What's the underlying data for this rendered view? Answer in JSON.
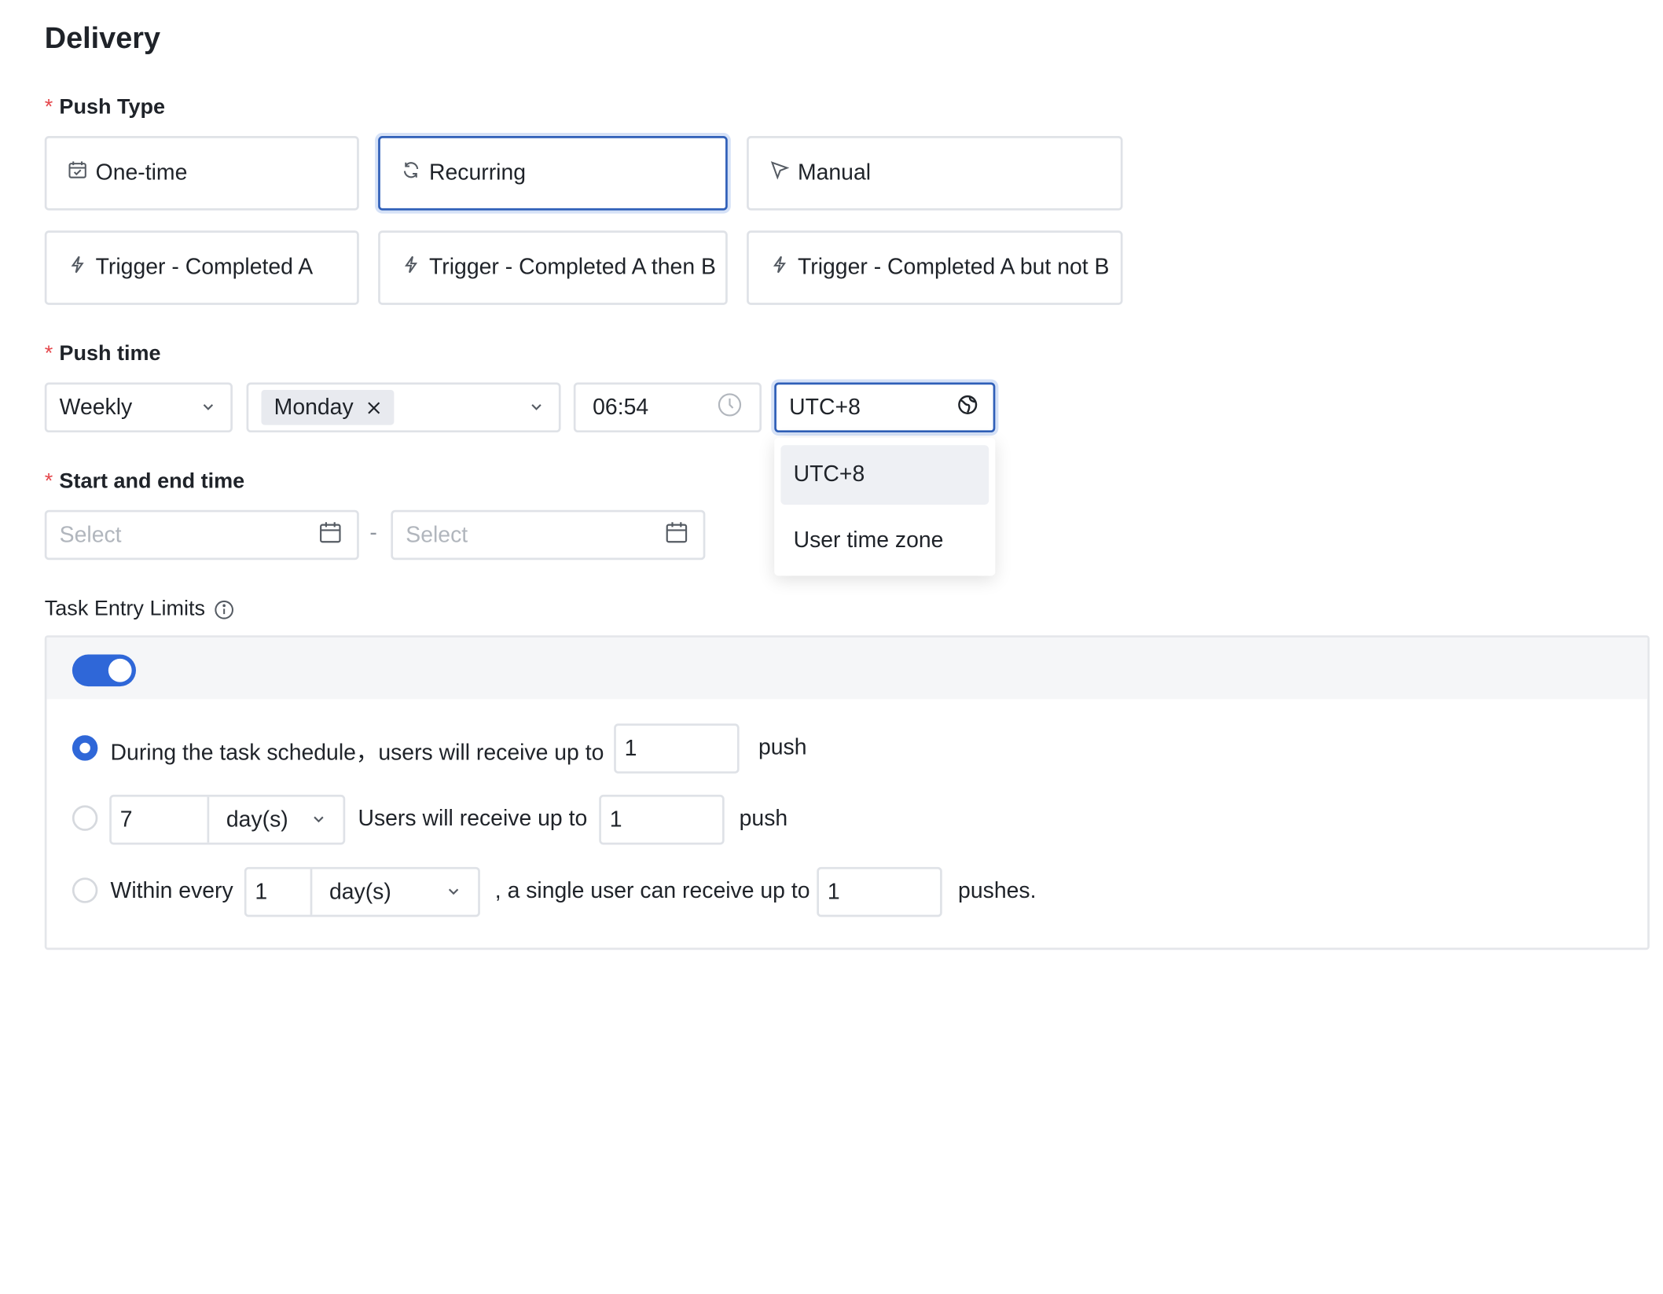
{
  "section_title": "Delivery",
  "push_type": {
    "label": "Push Type",
    "required_mark": "*",
    "options": [
      {
        "label": "One-time",
        "icon": "calendar-icon"
      },
      {
        "label": "Recurring",
        "icon": "refresh-icon",
        "selected": true
      },
      {
        "label": "Manual",
        "icon": "cursor-arrow-icon"
      },
      {
        "label": "Trigger - Completed A",
        "icon": "lightning-icon"
      },
      {
        "label": "Trigger - Completed A then B",
        "icon": "lightning-icon"
      },
      {
        "label": "Trigger - Completed A but not B",
        "icon": "lightning-icon"
      }
    ]
  },
  "push_time": {
    "label": "Push time",
    "required_mark": "*",
    "frequency": "Weekly",
    "day_tag": "Monday",
    "time": "06:54",
    "timezone": "UTC+8",
    "timezone_options": [
      "UTC+8",
      "User time zone"
    ]
  },
  "start_end": {
    "label": "Start and end time",
    "required_mark": "*",
    "start_placeholder": "Select",
    "end_placeholder": "Select",
    "separator": "-"
  },
  "limits": {
    "label": "Task Entry Limits",
    "enabled": true,
    "row1": {
      "text": "During the task schedule，users will receive up to",
      "value": "1",
      "suffix": "push",
      "selected": true
    },
    "row2": {
      "days": "7",
      "unit": "day(s)",
      "text": "Users will receive up to",
      "value": "1",
      "suffix": "push",
      "selected": false
    },
    "row3": {
      "prefix": "Within every",
      "days": "1",
      "unit": "day(s)",
      "text": ", a single user can receive up to",
      "value": "1",
      "suffix": "pushes.",
      "selected": false
    }
  },
  "colors": {
    "accent": "#2f67d8",
    "required": "#e5484d",
    "border": "#dfe2e7"
  }
}
